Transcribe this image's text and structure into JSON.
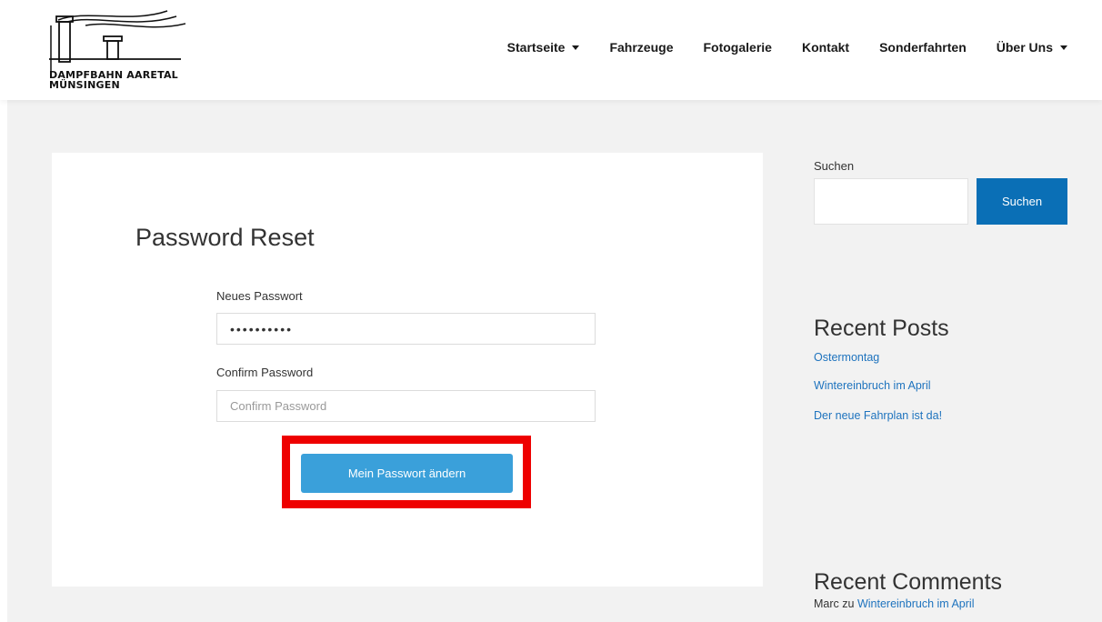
{
  "header": {
    "logo_lines": [
      "DAMPFBAHN AARETAL",
      "MÜNSINGEN"
    ],
    "nav": [
      {
        "label": "Startseite",
        "has_dropdown": true
      },
      {
        "label": "Fahrzeuge",
        "has_dropdown": false
      },
      {
        "label": "Fotogalerie",
        "has_dropdown": false
      },
      {
        "label": "Kontakt",
        "has_dropdown": false
      },
      {
        "label": "Sonderfahrten",
        "has_dropdown": false
      },
      {
        "label": "Über Uns",
        "has_dropdown": true
      }
    ]
  },
  "form": {
    "title": "Password Reset",
    "new_password_label": "Neues Passwort",
    "new_password_value": "••••••••••",
    "confirm_label": "Confirm Password",
    "confirm_placeholder": "Confirm Password",
    "submit_label": "Mein Passwort ändern"
  },
  "sidebar": {
    "search_label": "Suchen",
    "search_button": "Suchen",
    "recent_posts_title": "Recent Posts",
    "recent_posts": [
      "Ostermontag",
      "Wintereinbruch im April",
      "Der neue Fahrplan ist da!"
    ],
    "recent_comments_title": "Recent Comments",
    "comment_author": "Marc",
    "comment_connector": "zu",
    "comment_post": "Wintereinbruch im April"
  },
  "colors": {
    "accent_button": "#3aa0da",
    "search_button": "#0a6fb6",
    "link": "#1e73be",
    "highlight": "#ee0000"
  }
}
